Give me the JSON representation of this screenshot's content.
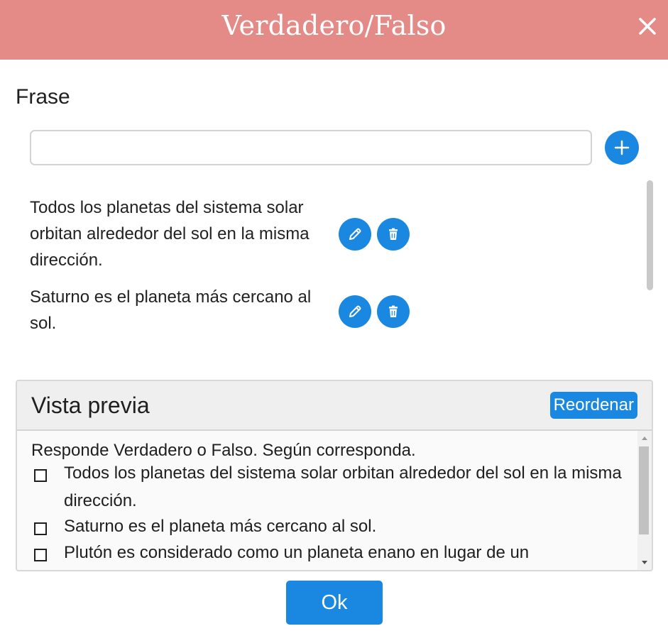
{
  "dialog": {
    "title": "Verdadero/Falso",
    "close_icon": "close-icon"
  },
  "form": {
    "section_label": "Frase",
    "input_value": "",
    "input_placeholder": "",
    "add_icon": "plus-icon"
  },
  "phrases": [
    {
      "text": "Todos los planetas del sistema solar orbitan alrededor del sol en la misma dirección.",
      "edit_icon": "pencil-icon",
      "delete_icon": "trash-icon"
    },
    {
      "text": "Saturno es el planeta más cercano al sol.",
      "edit_icon": "pencil-icon",
      "delete_icon": "trash-icon"
    }
  ],
  "preview": {
    "title": "Vista previa",
    "reorder_label": "Reordenar",
    "instructions": "Responde Verdadero o Falso. Según corresponda.",
    "items": [
      {
        "text": "Todos los planetas del sistema solar orbitan alrededor del sol en la misma dirección.",
        "checked": false
      },
      {
        "text": "Saturno es el planeta más cercano al sol.",
        "checked": false
      },
      {
        "text": "Plutón es considerado como un planeta enano en lugar de un",
        "checked": false
      }
    ]
  },
  "footer": {
    "ok_label": "Ok"
  },
  "colors": {
    "header": "#e48a87",
    "accent": "#1a88e0"
  }
}
